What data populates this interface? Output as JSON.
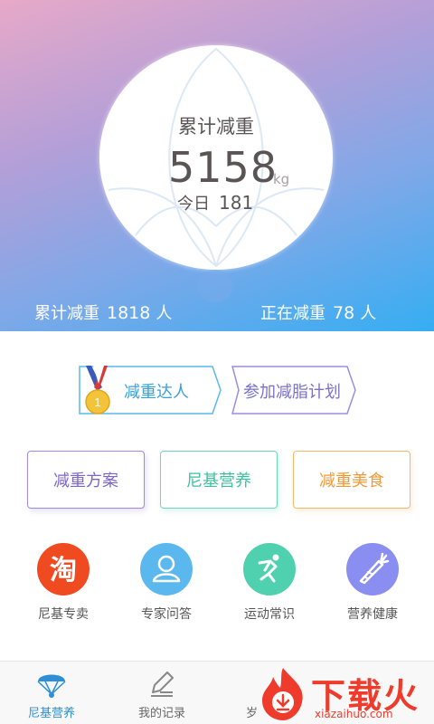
{
  "hero": {
    "card_title": "累计减重",
    "total_value": "5158",
    "unit": "kg",
    "today_label": "今日",
    "today_value": "181",
    "stat_left_label": "累计减重",
    "stat_left_value": "1818",
    "stat_left_unit": "人",
    "stat_right_label": "正在减重",
    "stat_right_value": "78",
    "stat_right_unit": "人"
  },
  "tags": {
    "master_label": "减重达人",
    "master_rank": "1",
    "join_label": "参加减脂计划"
  },
  "buttons": {
    "plan": "减重方案",
    "nutrition": "尼基营养",
    "food": "减重美食"
  },
  "categories": [
    {
      "label": "尼基专卖",
      "icon": "taobao-icon",
      "color": "#f04a20"
    },
    {
      "label": "专家问答",
      "icon": "user-icon",
      "color": "#5ab8ef"
    },
    {
      "label": "运动常识",
      "icon": "runner-icon",
      "color": "#4fd1b0"
    },
    {
      "label": "营养健康",
      "icon": "carrot-icon",
      "color": "#8a8ef0"
    }
  ],
  "tabbar": {
    "home": "尼基营养",
    "records": "我的记录",
    "third": "岁"
  },
  "watermark": {
    "text": "下载火",
    "sub": "xiazaihuo.com"
  }
}
